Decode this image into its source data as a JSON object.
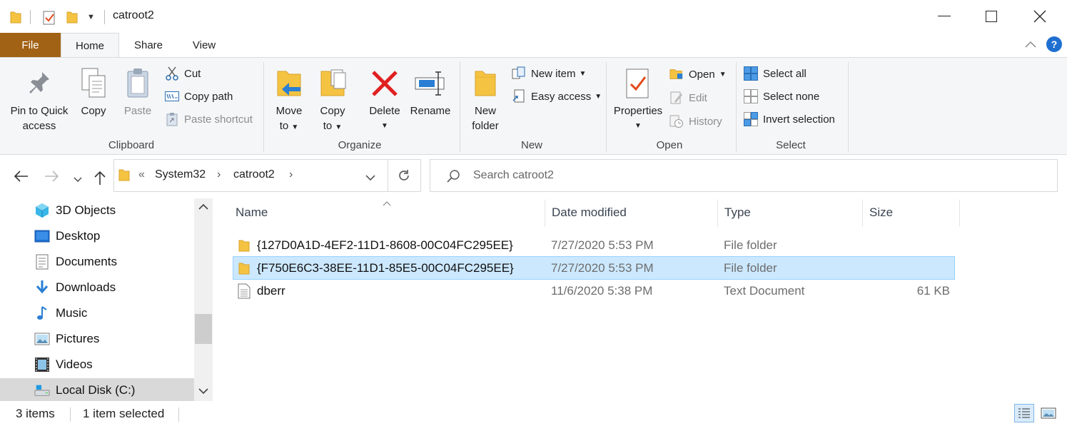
{
  "window": {
    "title": "catroot2",
    "minimize_glyph": "—",
    "maximize_glyph": "☐",
    "close_glyph": "✕"
  },
  "tabs": [
    {
      "label": "File"
    },
    {
      "label": "Home"
    },
    {
      "label": "Share"
    },
    {
      "label": "View"
    }
  ],
  "ribbon": {
    "clipboard": {
      "label": "Clipboard",
      "pin": "Pin to Quick access",
      "pin_line1": "Pin to Quick",
      "pin_line2": "access",
      "copy": "Copy",
      "paste": "Paste",
      "cut": "Cut",
      "copy_path": "Copy path",
      "paste_shortcut": "Paste shortcut"
    },
    "organize": {
      "label": "Organize",
      "move_to_line1": "Move",
      "move_to_line2": "to",
      "copy_to_line1": "Copy",
      "copy_to_line2": "to",
      "delete": "Delete",
      "rename": "Rename"
    },
    "new": {
      "label": "New",
      "new_folder_line1": "New",
      "new_folder_line2": "folder",
      "new_item": "New item",
      "easy_access": "Easy access"
    },
    "open": {
      "label": "Open",
      "properties": "Properties",
      "open": "Open",
      "edit": "Edit",
      "history": "History"
    },
    "select": {
      "label": "Select",
      "select_all": "Select all",
      "select_none": "Select none",
      "invert_selection": "Invert selection"
    }
  },
  "address": {
    "overflow": "«",
    "crumbs": [
      "System32",
      "catroot2"
    ],
    "separator": "›"
  },
  "search": {
    "placeholder": "Search catroot2"
  },
  "nav_pane": {
    "items": [
      {
        "label": "3D Objects",
        "icon": "cube-icon"
      },
      {
        "label": "Desktop",
        "icon": "desktop-icon"
      },
      {
        "label": "Documents",
        "icon": "documents-icon"
      },
      {
        "label": "Downloads",
        "icon": "downloads-icon"
      },
      {
        "label": "Music",
        "icon": "music-icon"
      },
      {
        "label": "Pictures",
        "icon": "pictures-icon"
      },
      {
        "label": "Videos",
        "icon": "videos-icon"
      },
      {
        "label": "Local Disk (C:)",
        "icon": "drive-icon"
      }
    ]
  },
  "file_list": {
    "columns": [
      "Name",
      "Date modified",
      "Type",
      "Size"
    ],
    "rows": [
      {
        "name": "{127D0A1D-4EF2-11D1-8608-00C04FC295EE}",
        "date": "7/27/2020 5:53 PM",
        "type": "File folder",
        "size": "",
        "icon": "folder-icon"
      },
      {
        "name": "{F750E6C3-38EE-11D1-85E5-00C04FC295EE}",
        "date": "7/27/2020 5:53 PM",
        "type": "File folder",
        "size": "",
        "icon": "folder-icon",
        "selected": true
      },
      {
        "name": "dberr",
        "date": "11/6/2020 5:38 PM",
        "type": "Text Document",
        "size": "61 KB",
        "icon": "text-file-icon"
      }
    ]
  },
  "status": {
    "item_count": "3 items",
    "selection": "1 item selected"
  },
  "colors": {
    "file_tab": "#a26215",
    "selection_bg": "#cce8ff",
    "selection_border": "#99d1ff",
    "folder_yellow": "#f5c342",
    "delete_red": "#e02020",
    "help_blue": "#1f6fd0"
  }
}
